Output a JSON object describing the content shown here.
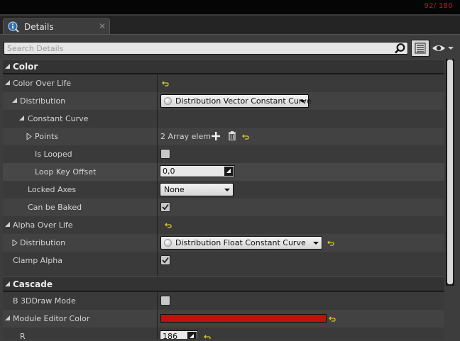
{
  "output": {
    "counter": "92/ 180"
  },
  "tab": {
    "label": "Details",
    "close": "✕"
  },
  "search": {
    "placeholder": "Search Details"
  },
  "colors": {
    "accent_reset": "#d6c72c",
    "module_editor_color": "#c0110d",
    "counter": "#b0242b"
  },
  "categories": {
    "color": "Color",
    "cascade": "Cascade"
  },
  "props": {
    "color_over_life": "Color Over Life",
    "distribution": "Distribution",
    "distribution_value": "Distribution Vector Constant Curve",
    "constant_curve": "Constant Curve",
    "points": "Points",
    "points_value": "2 Array elem",
    "is_looped": "Is Looped",
    "is_looped_checked": false,
    "loop_key_offset": "Loop Key Offset",
    "loop_key_offset_value": "0,0",
    "locked_axes": "Locked Axes",
    "locked_axes_value": "None",
    "can_be_baked": "Can be Baked",
    "can_be_baked_checked": true,
    "alpha_over_life": "Alpha Over Life",
    "alpha_distribution": "Distribution",
    "alpha_distribution_value": "Distribution Float Constant Curve",
    "clamp_alpha": "Clamp Alpha",
    "clamp_alpha_checked": true,
    "b3d_draw_mode": "B 3DDraw Mode",
    "b3d_draw_mode_checked": false,
    "module_editor_color": "Module Editor Color",
    "r": "R",
    "r_value": "186"
  }
}
